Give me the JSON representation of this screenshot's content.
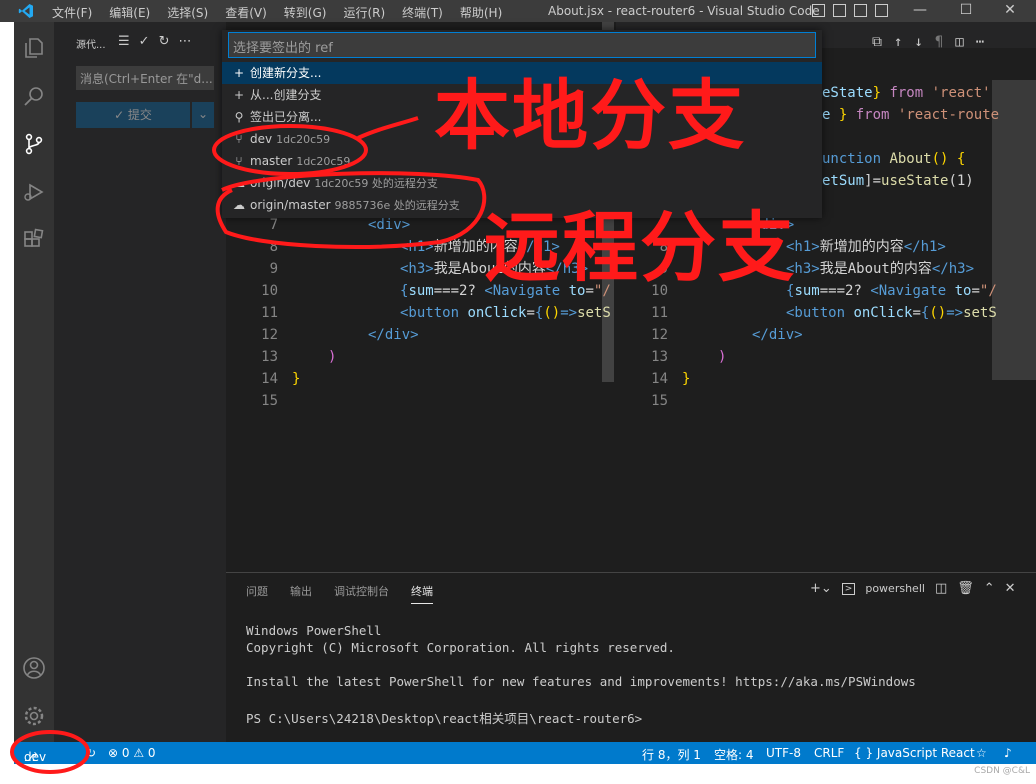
{
  "window": {
    "title": "About.jsx - react-router6 - Visual Studio Code"
  },
  "menu": [
    "文件(F)",
    "编辑(E)",
    "选择(S)",
    "查看(V)",
    "转到(G)",
    "运行(R)",
    "终端(T)",
    "帮助(H)"
  ],
  "sidebar": {
    "header": "源代...",
    "commit_placeholder": "消息(Ctrl+Enter 在\"d...",
    "commit_label": "✓ 提交"
  },
  "quickpick": {
    "placeholder": "选择要签出的 ref",
    "items": [
      {
        "icon": "+",
        "label": "创建新分支...",
        "desc": ""
      },
      {
        "icon": "+",
        "label": "从...创建分支",
        "desc": ""
      },
      {
        "icon": "⚲",
        "label": "签出已分离...",
        "desc": ""
      },
      {
        "icon": "⑂",
        "label": "dev",
        "desc": "1dc20c59"
      },
      {
        "icon": "⑂",
        "label": "master",
        "desc": "1dc20c59"
      },
      {
        "icon": "☁",
        "label": "origin/dev",
        "desc": "1dc20c59 处的远程分支"
      },
      {
        "icon": "☁",
        "label": "origin/master",
        "desc": "9885736e 处的远程分支"
      }
    ]
  },
  "editor_left": {
    "lines": [
      {
        "n": "7",
        "code": "      <div>"
      },
      {
        "n": "8",
        "code": "        <h1>新增加的内容</h1>"
      },
      {
        "n": "9",
        "code": "        <h3>我是About的内容</h3>"
      },
      {
        "n": "10",
        "code": "        {sum===2? <Navigate to=\"/"
      },
      {
        "n": "11",
        "code": "        <button onClick={()=>setS"
      },
      {
        "n": "12",
        "code": "      </div>"
      },
      {
        "n": "13",
        "code": "    )"
      },
      {
        "n": "14",
        "code": "}"
      },
      {
        "n": "15",
        "code": ""
      }
    ]
  },
  "editor_right": {
    "top_lines": [
      "eState} from 'react'",
      "e } from 'react-route",
      "",
      "unction About() {",
      "etSum]=useState(1)",
      "",
      ""
    ],
    "lines": [
      {
        "n": "7",
        "code": "      <div>"
      },
      {
        "n": "8",
        "code": "        <h1>新增加的内容</h1>"
      },
      {
        "n": "9",
        "code": "        <h3>我是About的内容</h3>"
      },
      {
        "n": "10",
        "code": "        {sum===2? <Navigate to=\"/"
      },
      {
        "n": "11",
        "code": "        <button onClick={()=>setS"
      },
      {
        "n": "12",
        "code": "      </div>"
      },
      {
        "n": "13",
        "code": "    )"
      },
      {
        "n": "14",
        "code": "}"
      },
      {
        "n": "15",
        "code": ""
      }
    ]
  },
  "panel": {
    "tabs": [
      "问题",
      "输出",
      "调试控制台",
      "终端"
    ],
    "shell": "powershell",
    "terminal": [
      "Windows PowerShell",
      "Copyright (C) Microsoft Corporation. All rights reserved.",
      "",
      "Install the latest PowerShell for new features and improvements! https://aka.ms/PSWindows",
      "",
      "PS C:\\Users\\24218\\Desktop\\react相关项目\\react-router6>"
    ]
  },
  "status": {
    "branch": "dev",
    "problems": "⊗ 0 ⚠ 0",
    "position": "行 8，列 1",
    "spaces": "空格: 4",
    "encoding": "UTF-8",
    "eol": "CRLF",
    "language": "{ }  JavaScript React"
  },
  "annotations": {
    "local": "本地分支",
    "remote": "远程分支"
  },
  "watermark": "CSDN @C&L"
}
